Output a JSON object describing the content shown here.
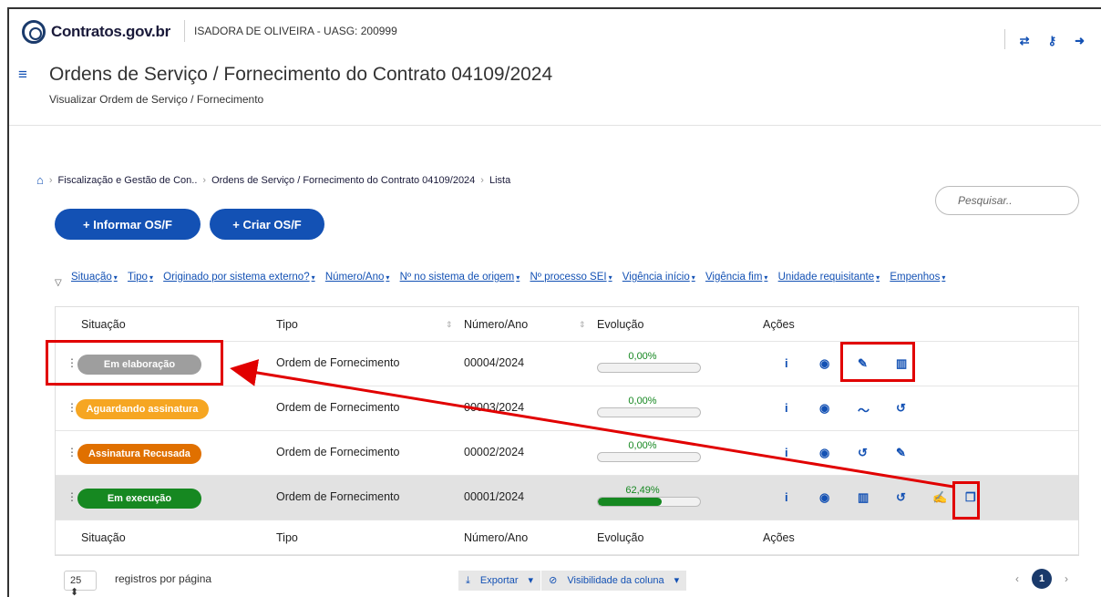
{
  "header": {
    "brand": "Contratos.gov.br",
    "user": "ISADORA DE OLIVEIRA - UASG: 200999",
    "icons": [
      "swap-icon",
      "key-icon",
      "logout-icon"
    ]
  },
  "page": {
    "title": "Ordens de Serviço / Fornecimento do Contrato 04109/2024",
    "subtitle": "Visualizar Ordem de Serviço / Fornecimento"
  },
  "breadcrumb": {
    "items": [
      "Fiscalização e Gestão de Con..",
      "Ordens de Serviço / Fornecimento do Contrato 04109/2024",
      "Lista"
    ]
  },
  "search": {
    "placeholder": "Pesquisar.."
  },
  "buttons": {
    "informar": "+ Informar OS/F",
    "criar": "+ Criar OS/F"
  },
  "filters": [
    "Situação",
    "Tipo",
    "Originado por sistema externo?",
    "Número/Ano",
    "Nº no sistema de origem",
    "Nº processo SEI",
    "Vigência início",
    "Vigência fim",
    "Unidade requisitante",
    "Empenhos"
  ],
  "table": {
    "columns": [
      "Situação",
      "Tipo",
      "Número/Ano",
      "Evolução",
      "Ações"
    ],
    "rows": [
      {
        "status": "Em elaboração",
        "status_color": "#9e9e9e",
        "tipo": "Ordem de Fornecimento",
        "numero": "00004/2024",
        "evolucao": "0,00%",
        "progress": 0
      },
      {
        "status": "Aguardando assinatura",
        "status_color": "#f6a622",
        "tipo": "Ordem de Fornecimento",
        "numero": "00003/2024",
        "evolucao": "0,00%",
        "progress": 0
      },
      {
        "status": "Assinatura Recusada",
        "status_color": "#e07000",
        "tipo": "Ordem de Fornecimento",
        "numero": "00002/2024",
        "evolucao": "0,00%",
        "progress": 0
      },
      {
        "status": "Em execução",
        "status_color": "#168821",
        "tipo": "Ordem de Fornecimento",
        "numero": "00001/2024",
        "evolucao": "62,49%",
        "progress": 0.6249
      }
    ]
  },
  "footer": {
    "per_page": "25",
    "per_page_label": "registros por página",
    "export": "Exportar",
    "visibility": "Visibilidade da coluna",
    "current_page": "1"
  },
  "colors": {
    "primary": "#1351b4",
    "annotation": "#e10000"
  }
}
